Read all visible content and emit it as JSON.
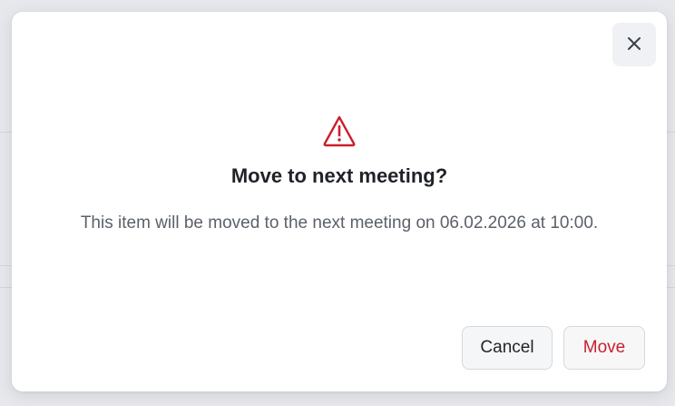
{
  "dialog": {
    "title": "Move to next meeting?",
    "message": "This item will be moved to the next meeting on 06.02.2026 at 10:00.",
    "icons": {
      "close": "close-icon",
      "warning": "warning-triangle-icon"
    },
    "buttons": {
      "cancel_label": "Cancel",
      "move_label": "Move"
    },
    "colors": {
      "danger": "#c8202f",
      "warning_icon": "#c8202f"
    }
  }
}
